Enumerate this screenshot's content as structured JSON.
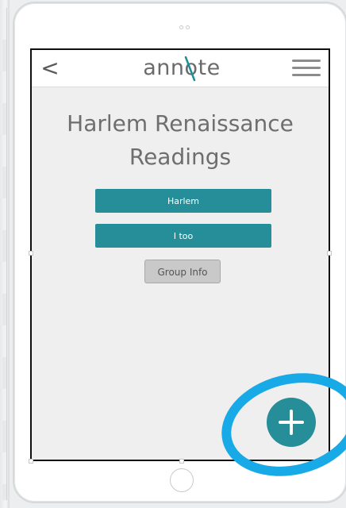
{
  "app": {
    "logo_text": "annote",
    "back_label": "<"
  },
  "page": {
    "title": "Harlem Renaissance Readings"
  },
  "readings": [
    {
      "label": "Harlem"
    },
    {
      "label": "I too"
    }
  ],
  "group_info": {
    "label": "Group Info"
  },
  "fab": {
    "icon": "plus-icon"
  },
  "colors": {
    "accent": "#268e98",
    "highlight": "#18a9e7",
    "title_text": "#6e6e6e",
    "group_button_bg": "#c9c9c9"
  }
}
